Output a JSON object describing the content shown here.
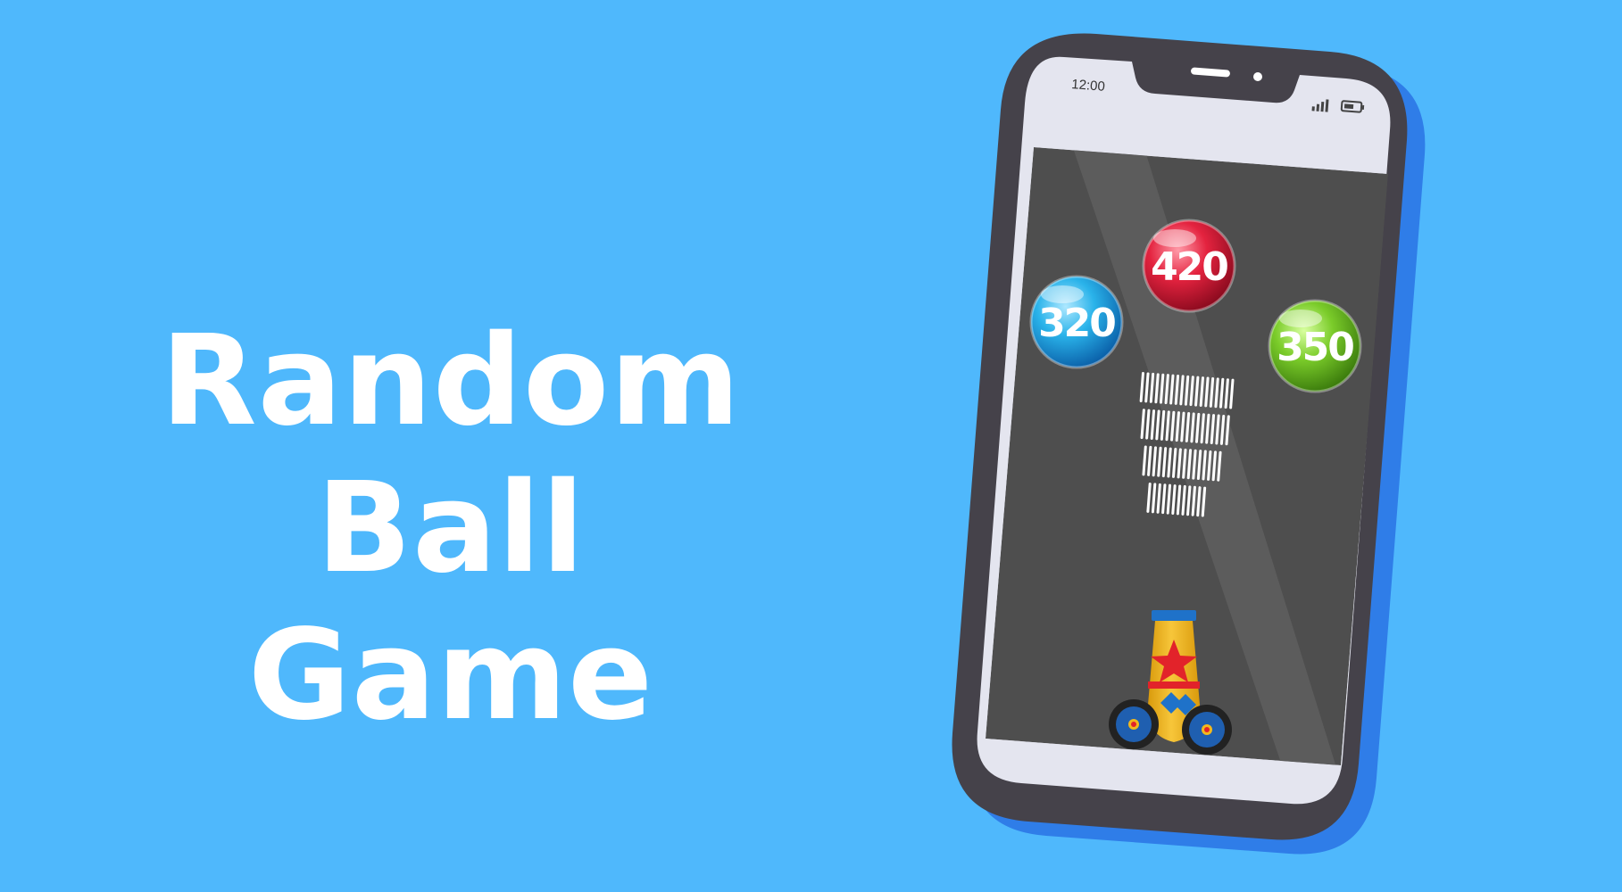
{
  "title": {
    "line1": "Random Ball",
    "line2": "Game"
  },
  "phone": {
    "status_time": "12:00"
  },
  "balls": [
    {
      "label": "320",
      "color": "#2ab3ea"
    },
    {
      "label": "420",
      "color": "#e4233f"
    },
    {
      "label": "350",
      "color": "#7bcc2a"
    }
  ],
  "colors": {
    "background": "#4fb8fc",
    "phone_frame": "#45424a",
    "phone_shadow": "#2f7de8",
    "bezel": "#e4e5ef",
    "game_bg": "#4e4e4e",
    "cannon_body": "#f3b81c",
    "cannon_star": "#e2232a",
    "cannon_accent": "#1f72c9"
  },
  "icons": [
    "signal-icon",
    "battery-icon",
    "star-icon"
  ]
}
